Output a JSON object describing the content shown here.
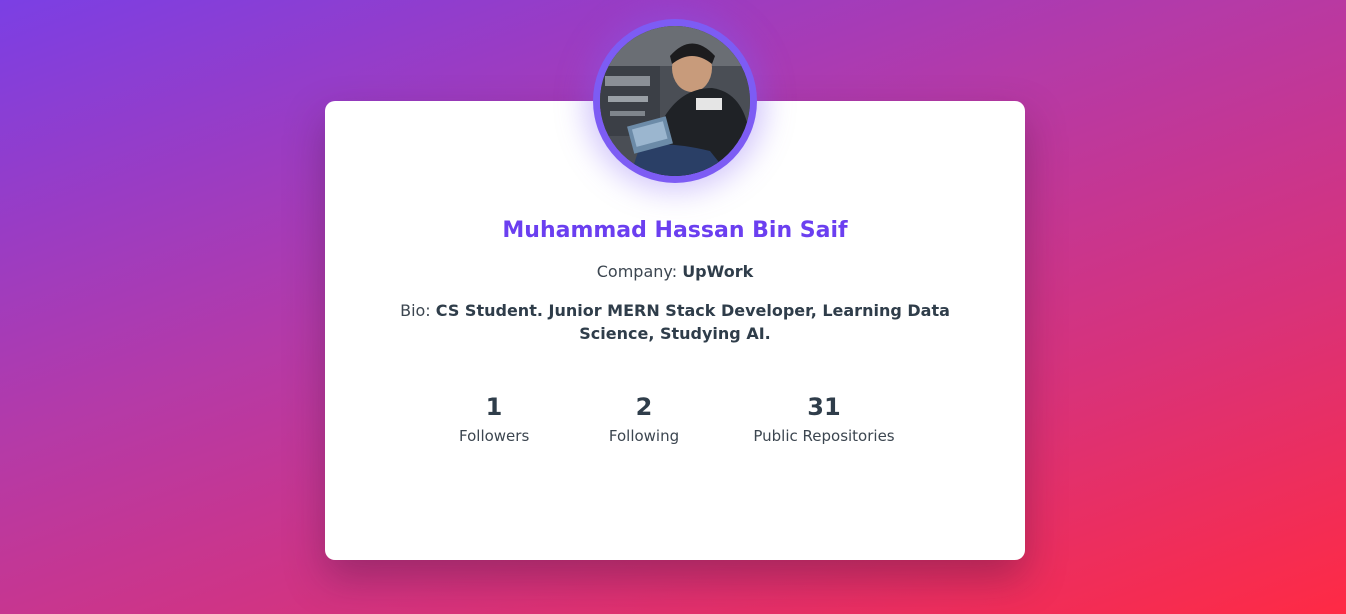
{
  "profile": {
    "name": "Muhammad Hassan Bin Saif",
    "company_label": "Company:",
    "company": "UpWork",
    "bio_label": "Bio:",
    "bio": "CS Student. Junior MERN Stack Developer, Learning Data Science, Studying AI."
  },
  "stats": [
    {
      "value": "1",
      "label": "Followers"
    },
    {
      "value": "2",
      "label": "Following"
    },
    {
      "value": "31",
      "label": "Public Repositories"
    }
  ],
  "colors": {
    "accent": "#6b3ff0",
    "avatar_ring": "#7d5cf4",
    "text": "#2f3d4a"
  }
}
